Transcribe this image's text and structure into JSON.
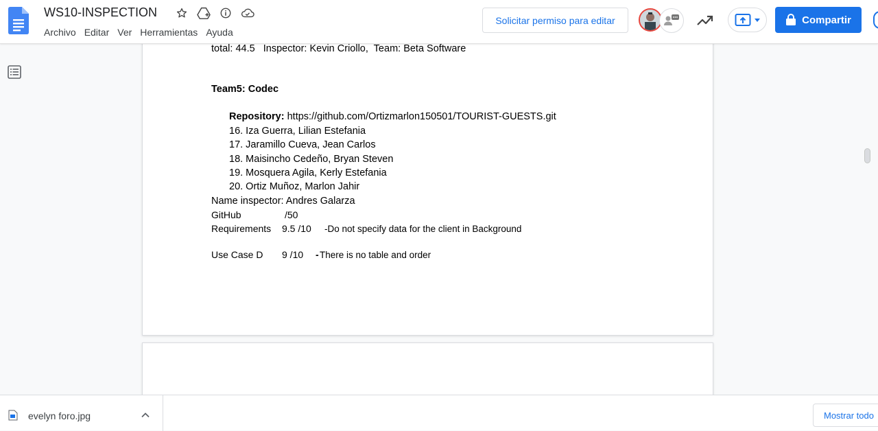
{
  "document": {
    "title": "WS10-INSPECTION"
  },
  "menu": {
    "items": [
      "Archivo",
      "Editar",
      "Ver",
      "Herramientas",
      "Ayuda"
    ]
  },
  "header_actions": {
    "request_edit_label": "Solicitar permiso para editar",
    "share_label": "Compartir",
    "accent_color": "#1a73e8"
  },
  "icons": {
    "title": [
      "star-icon",
      "move-to-drive-icon",
      "info-icon",
      "cloud-status-icon"
    ],
    "outline": "outline-icon",
    "activity": "trending-icon",
    "present": "present-icon",
    "share": "lock-icon"
  },
  "content": {
    "line_prev": "total: 44.5   Inspector: Kevin Criollo,  Team: Beta Software",
    "team_heading": "Team5: Codec",
    "repo_label": "Repository:",
    "repo_url": " https://github.com/Ortizmarlon150501/TOURIST-GUESTS.git",
    "members": [
      "16. Iza Guerra, Lilian Estefania",
      "17. Jaramillo Cueva, Jean Carlos",
      "18. Maisincho Cedeño, Bryan Steven",
      "19. Mosquera Agila, Kerly Estefania",
      "20. Ortiz Muñoz, Marlon Jahir"
    ],
    "inspector_line": "Name inspector: Andres Galarza",
    "github_label": "GitHub",
    "github_score": "/50",
    "requirements_label": "Requirements",
    "requirements_score": "9.5 /10",
    "requirements_note": "-Do not specify data for the client in Background",
    "usecase_label": "Use Case D",
    "usecase_score": "9 /10",
    "usecase_dash": "-",
    "usecase_note": "There is no table and order"
  },
  "downloads": {
    "file_name": "evelyn foro.jpg",
    "show_all_label": "Mostrar todo"
  }
}
